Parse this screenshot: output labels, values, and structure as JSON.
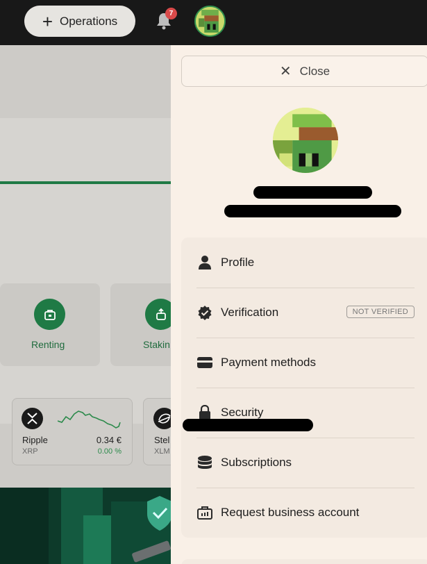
{
  "topbar": {
    "operations_label": "Operations",
    "notifications_count": "7"
  },
  "background": {
    "tiles": [
      {
        "label": "Renting"
      },
      {
        "label": "Stakin"
      }
    ],
    "coins": [
      {
        "name": "Ripple",
        "symbol": "XRP",
        "price": "0.34 €",
        "change": "0.00 %"
      },
      {
        "name": "Stel",
        "symbol": "XLM"
      }
    ]
  },
  "panel": {
    "close_label": "Close",
    "menu": [
      {
        "label": "Profile",
        "icon": "user-icon"
      },
      {
        "label": "Verification",
        "icon": "verified-badge-icon",
        "badge": "NOT VERIFIED"
      },
      {
        "label": "Payment methods",
        "icon": "card-icon"
      },
      {
        "label": "Security",
        "icon": "lock-icon"
      },
      {
        "label": "Subscriptions",
        "icon": "coins-stack-icon"
      },
      {
        "label": "Request business account",
        "icon": "briefcase-icon"
      }
    ]
  },
  "colors": {
    "accent_green": "#1f7a45",
    "panel_bg": "#f9f0e7",
    "topbar_bg": "#181818",
    "badge_red": "#d94a4a"
  }
}
